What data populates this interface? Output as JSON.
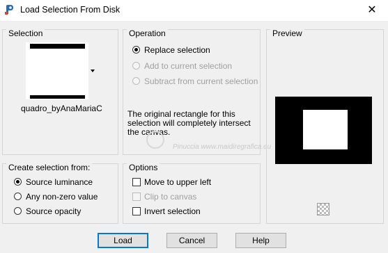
{
  "window": {
    "title": "Load Selection From Disk",
    "close_glyph": "✕"
  },
  "selection": {
    "group_title": "Selection",
    "selected_name": "quadro_byAnaMariaC"
  },
  "operation": {
    "group_title": "Operation",
    "options": [
      {
        "label": "Replace selection",
        "checked": true,
        "enabled": true
      },
      {
        "label": "Add to current selection",
        "checked": false,
        "enabled": false
      },
      {
        "label": "Subtract from current selection",
        "checked": false,
        "enabled": false
      }
    ],
    "description": "The original rectangle for this selection will completely intersect the canvas."
  },
  "preview": {
    "group_title": "Preview"
  },
  "create_from": {
    "group_title": "Create selection from:",
    "options": [
      {
        "label": "Source luminance",
        "checked": true
      },
      {
        "label": "Any non-zero value",
        "checked": false
      },
      {
        "label": "Source opacity",
        "checked": false
      }
    ]
  },
  "options": {
    "group_title": "Options",
    "checks": [
      {
        "label": "Move to upper left",
        "checked": false,
        "enabled": true
      },
      {
        "label": "Clip to canvas",
        "checked": false,
        "enabled": false
      },
      {
        "label": "Invert selection",
        "checked": false,
        "enabled": true
      }
    ]
  },
  "watermark": {
    "text": "Pinuccia www.maidiregrafica.eu"
  },
  "buttons": {
    "load": "Load",
    "cancel": "Cancel",
    "help": "Help"
  },
  "icons": {
    "app": "psp-app-icon",
    "close": "close-icon",
    "dropdown": "chevron-down-icon",
    "preview_toggle": "checkerboard-icon"
  }
}
